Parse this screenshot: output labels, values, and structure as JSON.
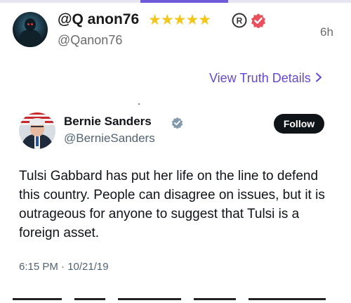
{
  "post": {
    "display_name": "@Q anon76",
    "stars": "★★★★★",
    "handle": "@Qanon76",
    "time": "6h",
    "view_details_label": "View Truth Details",
    "view_details_chevron": "›"
  },
  "embedded_tweet": {
    "name": "Bernie Sanders",
    "handle": "@BernieSanders",
    "follow_label": "Follow",
    "text": "Tulsi Gabbard has put her life on the line to defend this country. People can disagree on issues, but it is outrageous for anyone to suggest that Tulsi is a foreign asset.",
    "timestamp": "6:15 PM · 10/21/19"
  },
  "colors": {
    "accent": "#6548d8",
    "star": "#f4c51a",
    "verified_badge": "#e94f5d",
    "twitter_verified": "#829aab"
  },
  "icons": {
    "registered": "registered-icon",
    "verified": "verified-badge-icon",
    "chevron": "chevron-right-icon"
  }
}
